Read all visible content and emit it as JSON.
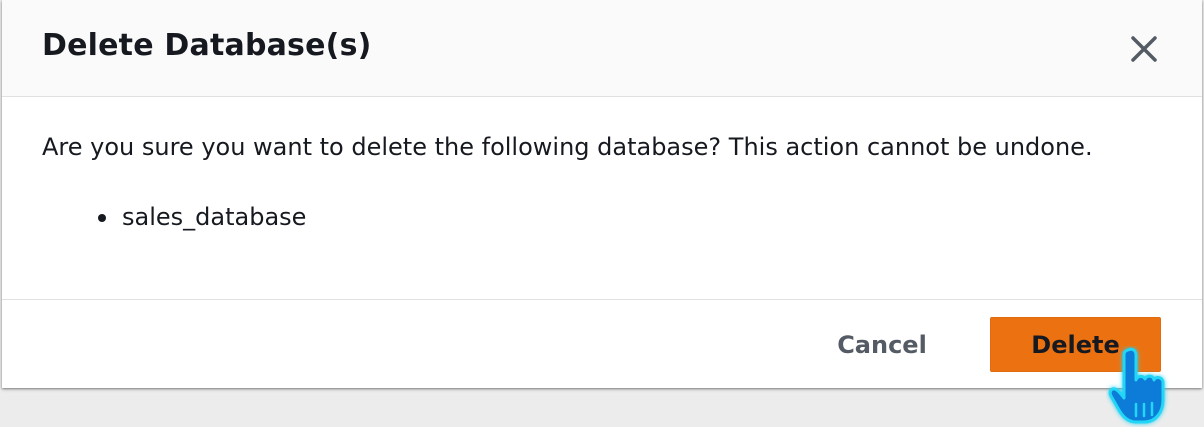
{
  "dialog": {
    "title": "Delete Database(s)",
    "close_icon": "close-icon",
    "message": "Are you sure you want to delete the following database? This action cannot be undone.",
    "databases": [
      "sales_database"
    ],
    "buttons": {
      "cancel_label": "Cancel",
      "delete_label": "Delete"
    }
  },
  "colors": {
    "primary_button": "#ec7211",
    "header_bg": "#fafafa",
    "text": "#16191f",
    "secondary_text": "#545b64",
    "backdrop": "#ececec",
    "cursor": "#0a7bd8"
  },
  "cursor": {
    "icon": "hand-pointer-icon"
  }
}
